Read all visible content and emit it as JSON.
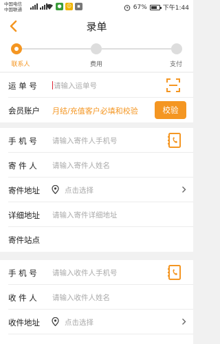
{
  "status_bar": {
    "carrier1": "中国电信",
    "carrier2": "中国联通",
    "battery": "67%",
    "time": "下午1:44"
  },
  "header": {
    "title": "录单",
    "back_icon": "chevron-left-icon"
  },
  "steps": [
    {
      "label": "联系人",
      "active": true
    },
    {
      "label": "费用",
      "active": false
    },
    {
      "label": "支付",
      "active": false
    }
  ],
  "waybill": {
    "label": "运 单 号",
    "placeholder": "请输入运单号",
    "icon": "scan-icon"
  },
  "member": {
    "label": "会员账户",
    "hint": "月结/充值客户必填和校验",
    "button": "校验"
  },
  "sender": {
    "phone_label": "手 机 号",
    "phone_placeholder": "请输入寄件人手机号",
    "name_label": "寄 件 人",
    "name_placeholder": "请输入寄件人姓名",
    "address_label": "寄件地址",
    "address_placeholder": "点击选择",
    "detail_label": "详细地址",
    "detail_placeholder": "请输入寄件详细地址",
    "station_label": "寄件站点"
  },
  "receiver": {
    "phone_label": "手 机 号",
    "phone_placeholder": "请输入收件人手机号",
    "name_label": "收 件 人",
    "name_placeholder": "请输入收件人姓名",
    "address_label": "收件地址",
    "address_placeholder": "点击选择"
  },
  "colors": {
    "accent": "#f49622",
    "background": "#f1f1f1"
  }
}
